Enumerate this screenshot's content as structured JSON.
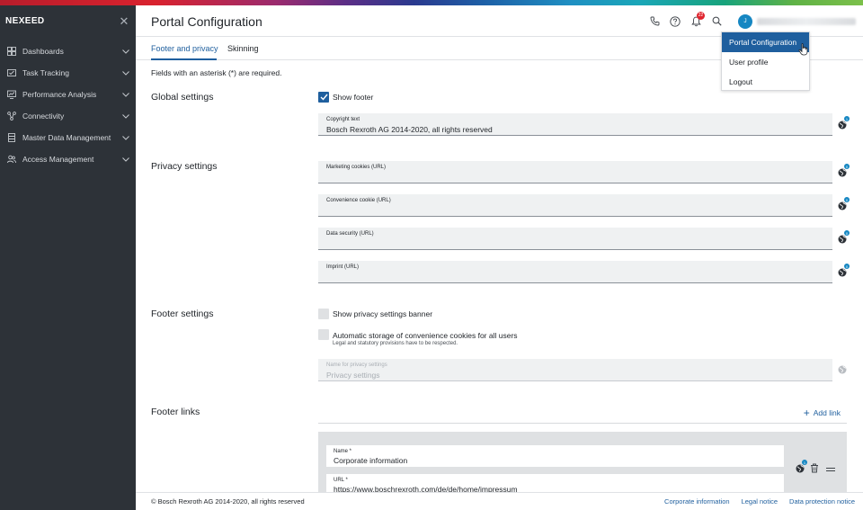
{
  "app": {
    "brand": "NEXEED"
  },
  "sidebar": {
    "items": [
      {
        "label": "Dashboards",
        "icon": "dashboard-icon"
      },
      {
        "label": "Task Tracking",
        "icon": "task-tracking-icon"
      },
      {
        "label": "Performance Analysis",
        "icon": "performance-analysis-icon"
      },
      {
        "label": "Connectivity",
        "icon": "connectivity-icon"
      },
      {
        "label": "Master Data Management",
        "icon": "database-icon"
      },
      {
        "label": "Access Management",
        "icon": "users-icon"
      }
    ]
  },
  "header": {
    "title": "Portal Configuration",
    "notification_count": "22",
    "avatar_initial": "J"
  },
  "tabs": [
    {
      "label": "Footer and privacy",
      "active": true
    },
    {
      "label": "Skinning",
      "active": false
    }
  ],
  "main": {
    "required_note": "Fields with an asterisk (*) are required.",
    "global": {
      "title": "Global settings",
      "show_footer_label": "Show footer",
      "show_footer_checked": true,
      "copyright_label": "Copyright text",
      "copyright_value": "Bosch Rexroth AG 2014-2020, all rights reserved",
      "copyright_badge": "1"
    },
    "privacy": {
      "title": "Privacy settings",
      "fields": [
        {
          "label": "Marketing cookies (URL)",
          "value": "",
          "badge": "0"
        },
        {
          "label": "Convenience cookie (URL)",
          "value": "",
          "badge": "0"
        },
        {
          "label": "Data security (URL)",
          "value": "",
          "badge": "0"
        },
        {
          "label": "Imprint (URL)",
          "value": "",
          "badge": "0"
        }
      ]
    },
    "footer_settings": {
      "title": "Footer settings",
      "show_banner_label": "Show privacy settings banner",
      "show_banner_checked": false,
      "auto_storage_label": "Automatic storage of convenience cookies for all users",
      "auto_storage_sub": "Legal and statutory provisions have to be respected.",
      "auto_storage_checked": false,
      "privacy_name_label": "Name for privacy settings",
      "privacy_name_value": "Privacy settings"
    },
    "footer_links": {
      "title": "Footer links",
      "add_link_label": "Add link",
      "link": {
        "name_label": "Name *",
        "name_value": "Corporate information",
        "url_label": "URL *",
        "url_value": "https://www.boschrexroth.com/de/de/home/impressum",
        "badge": "1"
      }
    }
  },
  "user_menu": {
    "items": [
      {
        "label": "Portal Configuration",
        "active": true
      },
      {
        "label": "User profile",
        "active": false
      },
      {
        "label": "Logout",
        "active": false
      }
    ]
  },
  "footer": {
    "copyright": "© Bosch Rexroth AG 2014-2020, all rights reserved",
    "links": [
      "Corporate information",
      "Legal notice",
      "Data protection notice"
    ]
  },
  "colors": {
    "accent": "#1f5f9e",
    "sidebar_bg": "#2d3238",
    "badge_red": "#e0242e",
    "avatar_blue": "#1687c2"
  }
}
